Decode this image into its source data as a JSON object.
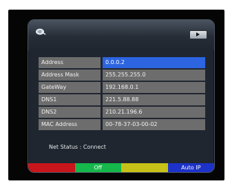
{
  "fields": [
    {
      "label": "Address",
      "value": "0.0.0.2"
    },
    {
      "label": "Address Mask",
      "value": "255.255.255.0"
    },
    {
      "label": "GateWay",
      "value": "192.168.0.1"
    },
    {
      "label": "DNS1",
      "value": "221.5.88.88"
    },
    {
      "label": "DNS2",
      "value": "210.21.196.6"
    },
    {
      "label": "MAC Address",
      "value": "00-78-37-03-00-02"
    }
  ],
  "selected_field_index": 0,
  "status": {
    "text": "Net Status : Connect"
  },
  "color_buttons": {
    "red": "",
    "green": "Off",
    "yellow": "",
    "blue": "Auto IP"
  },
  "icons": {
    "top_left": "satellite-dish-icon",
    "top_right": "play-icon"
  },
  "colors": {
    "panel": "#1f2630",
    "field_bg": "#6d6d6d",
    "selected_field": "#2d65e0",
    "red": "#c9151c",
    "green": "#15b84a",
    "yellow": "#c6c217",
    "blue": "#1d32c8"
  }
}
